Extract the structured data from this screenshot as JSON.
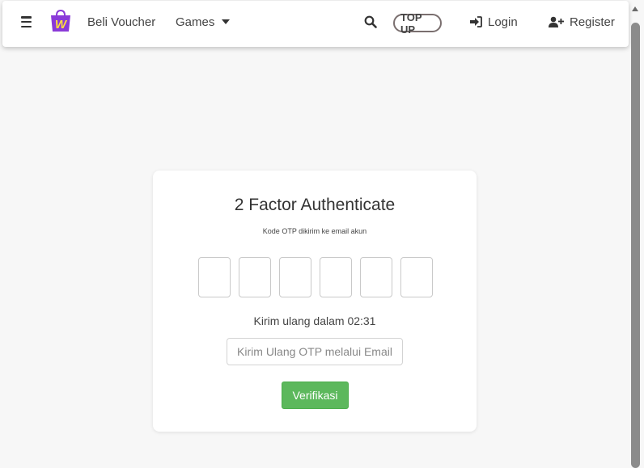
{
  "navbar": {
    "menu_icon": "hamburger-icon",
    "logo_icon": "shopping-bag-w-logo",
    "beli_voucher": "Beli Voucher",
    "games": "Games",
    "search_icon": "search-icon",
    "top_up": "TOP UP",
    "login": "Login",
    "register": "Register"
  },
  "card": {
    "title": "2 Factor Authenticate",
    "subtitle": "Kode OTP dikirim ke email akun",
    "otp_digits": [
      "",
      "",
      "",
      "",
      "",
      ""
    ],
    "resend_timer": "Kirim ulang dalam 02:31",
    "resend_email_button": "Kirim Ulang OTP melalui Email",
    "verify_button": "Verifikasi"
  },
  "colors": {
    "brand_purple": "#8a3ad8",
    "verify_green": "#5cb85c",
    "background": "#f7f7f7"
  }
}
